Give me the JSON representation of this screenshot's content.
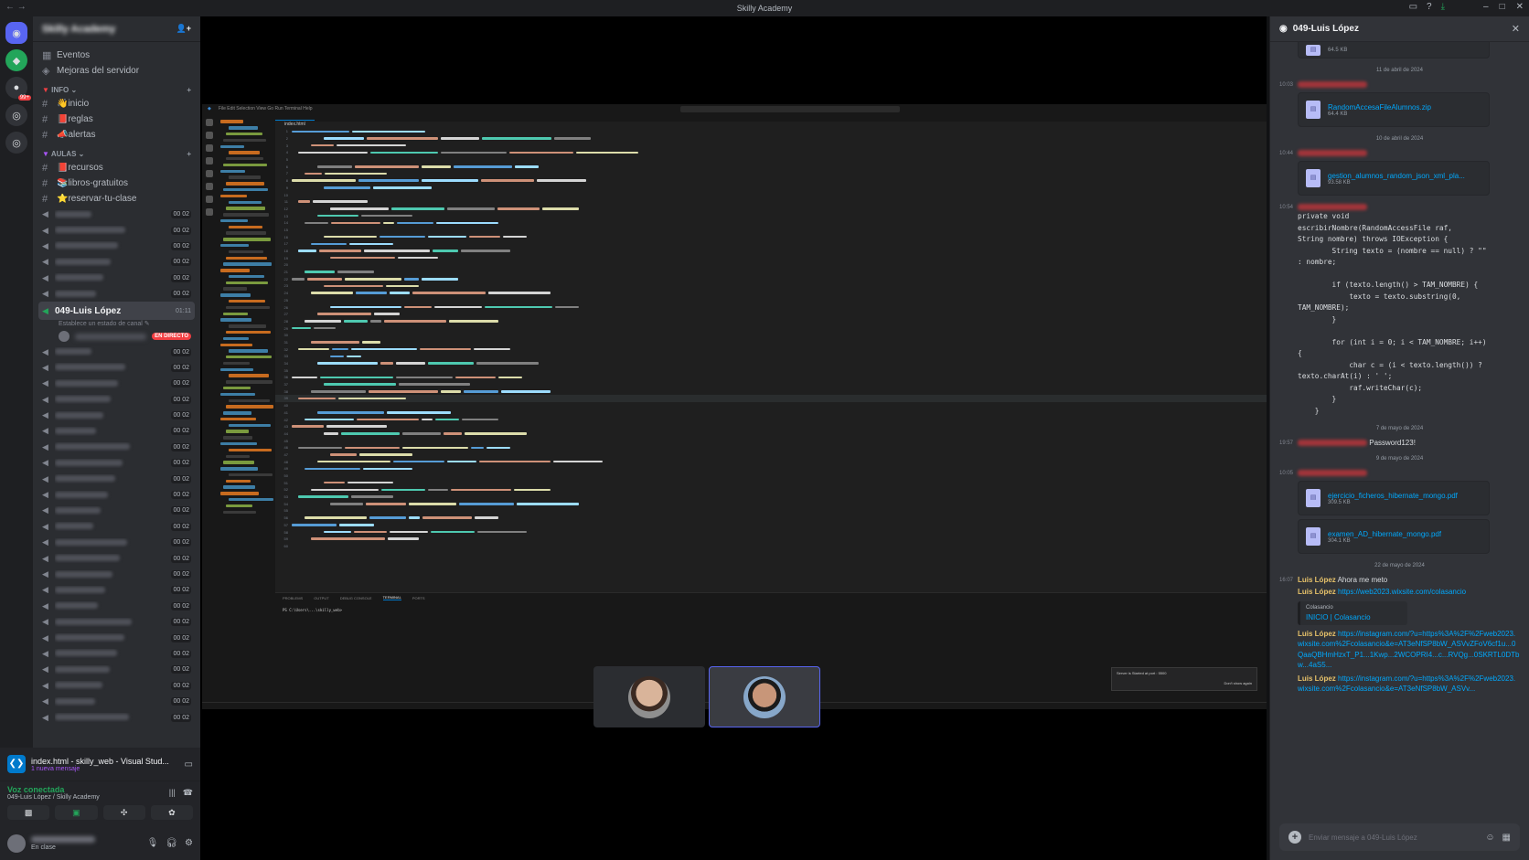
{
  "window": {
    "title": "Skilly Academy",
    "back": "←",
    "forward": "→",
    "title_icons": [
      "inbox-icon",
      "help-icon",
      "download-icon"
    ],
    "min": "–",
    "max": "□",
    "close": "✕"
  },
  "guild": {
    "name": "Skilly Academy",
    "add_user": "👤+"
  },
  "top_items": [
    {
      "label": "Eventos",
      "icon": "calendar-icon"
    },
    {
      "label": "Mejoras del servidor",
      "icon": "boost-icon"
    }
  ],
  "categories": {
    "info": {
      "label": "INFO",
      "channels": [
        "👋inicio",
        "📕reglas",
        "📣alertas"
      ]
    },
    "aulas": {
      "label": "AULAS",
      "channels": [
        "📕recursos",
        "📚libros-gratuitos",
        "⭐reservar-tu-clase"
      ]
    }
  },
  "voice_channels_before": [
    {
      "count": "00 02"
    },
    {
      "count": "00 02"
    },
    {
      "count": "00 02"
    },
    {
      "count": "00 02"
    },
    {
      "count": "00 02"
    },
    {
      "count": "00 02"
    }
  ],
  "active_voice": {
    "name": "049-Luis López",
    "timer": "01:11",
    "status_hint": "Establece un estado de canal ✎",
    "live_badge": "EN DIRECTO"
  },
  "voice_channels_after": [
    {
      "count": "00 02"
    },
    {
      "count": "00 02"
    },
    {
      "count": "00 02"
    },
    {
      "count": "00 02"
    },
    {
      "count": "00 02"
    },
    {
      "count": "00 02"
    },
    {
      "count": "00 02"
    },
    {
      "count": "00 02"
    },
    {
      "count": "00 02"
    },
    {
      "count": "00 02"
    },
    {
      "count": "00 02"
    },
    {
      "count": "00 02"
    },
    {
      "count": "00 02"
    },
    {
      "count": "00 02"
    },
    {
      "count": "00 02"
    },
    {
      "count": "00 02"
    },
    {
      "count": "00 02"
    },
    {
      "count": "00 02"
    },
    {
      "count": "00 02"
    },
    {
      "count": "00 02"
    },
    {
      "count": "00 02"
    },
    {
      "count": "00 02"
    },
    {
      "count": "00 02"
    },
    {
      "count": "00 02"
    }
  ],
  "activity": {
    "title": "index.html - skilly_web - Visual Stud...",
    "sub": "1 nueva mensaje"
  },
  "voice_status": {
    "title": "Voz conectada",
    "sub": "049-Luis López / Skilly Academy"
  },
  "user": {
    "status": "En clase"
  },
  "stream": {
    "editor_tab": "index.html",
    "terminal_tabs": [
      "PROBLEMS",
      "OUTPUT",
      "DEBUG CONSOLE",
      "TERMINAL",
      "PORTS"
    ],
    "terminal_line": "PS C:\\Users\\...\\skilly_web> ",
    "toast_title": "Server is Started at port : 5500",
    "toast_action": "Don't show again"
  },
  "dm": {
    "title": "049-Luis López",
    "input_placeholder": "Enviar mensaje a 049-Luis López",
    "top_file_size": "64.5 KB",
    "dates": [
      "11 de abril de 2024",
      "10 de abril de 2024",
      "7 de mayo de 2024",
      "9 de mayo de 2024",
      "22 de mayo de 2024"
    ],
    "msgs": {
      "t1": "10:03",
      "f1": {
        "name": "RandomAccesaFileAlumnos.zip",
        "size": "64.4 KB"
      },
      "t2": "10:44",
      "f2": {
        "name": "gestion_alumnos_random_json_xml_pla...",
        "size": "93.58 KB"
      },
      "t3": "10:54",
      "code": "private void\nescribirNombre(RandomAccessFile raf,\nString nombre) throws IOException {\n        String texto = (nombre == null) ? \"\"\n: nombre;\n\n        if (texto.length() > TAM_NOMBRE) {\n            texto = texto.substring(0,\nTAM_NOMBRE);\n        }\n\n        for (int i = 0; i < TAM_NOMBRE; i++)\n{\n            char c = (i < texto.length()) ?\ntexto.charAt(i) : ' ';\n            raf.writeChar(c);\n        }\n    }",
      "t4": "19:57",
      "password": "Password123!",
      "t5": "10:05",
      "f3": {
        "name": "ejercicio_ficheros_hibernate_mongo.pdf",
        "size": "309.5 KB"
      },
      "f4": {
        "name": "examen_AD_hibernate_mongo.pdf",
        "size": "304.1 KB"
      },
      "t6": "16:07",
      "luis": "Luis López",
      "m1": "Ahora me meto",
      "link1": "https://web2023.wixsite.com/colasancio",
      "embed_provider": "Colasancio",
      "embed_title": "INICIO | Colasancio",
      "link2": "https://instagram.com/?u=https%3A%2F%2Fweb2023.wixsite.com%2Fcolasancio&e=AT3eNfSP8bW_ASVvZFoV6cf1u...0QaaQBHmHzxT_P1...1Kwp...2WCOPRI4...c...RVQg...0SKRTL0DTbw...4aS5...",
      "link3": "https://instagram.com/?u=https%3A%2F%2Fweb2023.wixsite.com%2Fcolasancio&e=AT3eNfSP8bW_ASVv..."
    }
  },
  "colors": {
    "accent": "#5865f2",
    "live": "#f23f43",
    "link": "#00a8fc",
    "online": "#23a55a"
  }
}
